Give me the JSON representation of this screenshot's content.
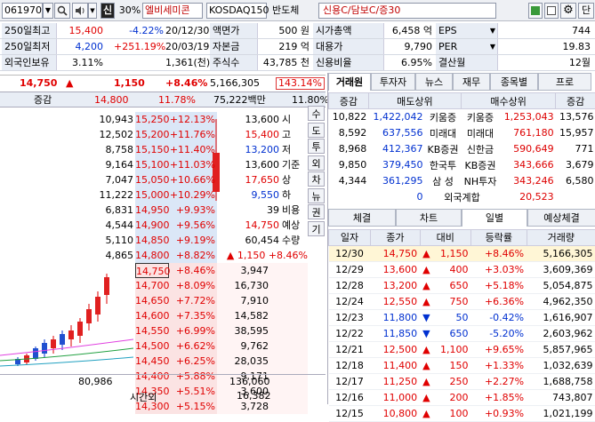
{
  "toolbar": {
    "code": "061970",
    "toggle_label": "신",
    "pct_badge": "30%",
    "name": "엘비세미콘",
    "market": "KOSDAQ150",
    "sector": "반도체",
    "credit": "신용C/담보C/증30"
  },
  "info": {
    "rows": [
      [
        {
          "k": "250일최고",
          "dd": "▼"
        },
        {
          "v": "15,400",
          "cls": "red"
        },
        {
          "v": "-4.22%",
          "cls": "blue"
        },
        {
          "v": "20/12/30"
        },
        {
          "k": "액면가"
        },
        {
          "v": "500 원"
        },
        {
          "k": "시가총액"
        },
        {
          "v": "6,458 억"
        },
        {
          "k": "EPS",
          "dd": "▼"
        },
        {
          "v": "744"
        }
      ],
      [
        {
          "k": "250일최저",
          "dd": "▼"
        },
        {
          "v": "4,200",
          "cls": "blue"
        },
        {
          "v": "+251.19%",
          "cls": "red"
        },
        {
          "v": "20/03/19"
        },
        {
          "k": "자본금"
        },
        {
          "v": "219 억"
        },
        {
          "k": "대용가"
        },
        {
          "v": "9,790"
        },
        {
          "k": "PER",
          "dd": "▼"
        },
        {
          "v": "19.83"
        }
      ],
      [
        {
          "k": "외국인보유"
        },
        {
          "v": "3.11%"
        },
        {
          "v": ""
        },
        {
          "v": "1,361(천)"
        },
        {
          "k": "주식수"
        },
        {
          "v": "43,785 천"
        },
        {
          "k": "신용비율"
        },
        {
          "v": "6.95%"
        },
        {
          "k": "결산월"
        },
        {
          "v": "12월"
        }
      ]
    ]
  },
  "price": {
    "current": "14,750",
    "arrow": "▲",
    "change": "1,150",
    "pct": "+8.46%",
    "volume": "5,166,305",
    "vol_ratio": "143.14%"
  },
  "ob_header": {
    "label": "증감",
    "price": "14,800",
    "pct": "11.78%",
    "amount": "75,222백만",
    "pct2": "11.80%"
  },
  "asks": [
    {
      "qty": "10,943",
      "price": "15,250",
      "pct": "+12.13%"
    },
    {
      "qty": "12,502",
      "price": "15,200",
      "pct": "+11.76%"
    },
    {
      "qty": "8,758",
      "price": "15,150",
      "pct": "+11.40%"
    },
    {
      "qty": "9,164",
      "price": "15,100",
      "pct": "+11.03%"
    },
    {
      "qty": "7,047",
      "price": "15,050",
      "pct": "+10.66%"
    },
    {
      "qty": "11,222",
      "price": "15,000",
      "pct": "+10.29%"
    },
    {
      "qty": "6,831",
      "price": "14,950",
      "pct": "+9.93%"
    },
    {
      "qty": "4,544",
      "price": "14,900",
      "pct": "+9.56%"
    },
    {
      "qty": "5,110",
      "price": "14,850",
      "pct": "+9.19%"
    },
    {
      "qty": "4,865",
      "price": "14,800",
      "pct": "+8.82%"
    }
  ],
  "summary": [
    {
      "v": "13,600",
      "k": "시",
      "vcls": "bk"
    },
    {
      "v": "15,400",
      "k": "고",
      "vcls": "red"
    },
    {
      "v": "13,200",
      "k": "저",
      "vcls": "blue"
    },
    {
      "v": "13,600",
      "k": "기준",
      "vcls": "bk"
    },
    {
      "v": "17,650",
      "k": "상",
      "vcls": "red"
    },
    {
      "v": "9,550",
      "k": "하",
      "vcls": "blue"
    },
    {
      "v": "39",
      "k": "비용",
      "vcls": "bk"
    },
    {
      "v": "14,750",
      "k": "예상",
      "vcls": "red"
    },
    {
      "v": "60,454",
      "k": "수량",
      "vcls": "bk"
    },
    {
      "v": "▲ 1,150  +8.46%",
      "k": "",
      "vcls": "red"
    }
  ],
  "side_tabs": [
    "수",
    "도",
    "투",
    "외",
    "차",
    "뉴",
    "권",
    "기"
  ],
  "bids": [
    {
      "price": "14,750",
      "pct": "+8.46%",
      "qty": "3,947"
    },
    {
      "price": "14,700",
      "pct": "+8.09%",
      "qty": "16,730"
    },
    {
      "price": "14,650",
      "pct": "+7.72%",
      "qty": "7,910"
    },
    {
      "price": "14,600",
      "pct": "+7.35%",
      "qty": "14,582"
    },
    {
      "price": "14,550",
      "pct": "+6.99%",
      "qty": "38,595"
    },
    {
      "price": "14,500",
      "pct": "+6.62%",
      "qty": "9,762"
    },
    {
      "price": "14,450",
      "pct": "+6.25%",
      "qty": "28,035"
    },
    {
      "price": "14,400",
      "pct": "+5.88%",
      "qty": "9,171"
    },
    {
      "price": "14,350",
      "pct": "+5.51%",
      "qty": "3,600"
    },
    {
      "price": "14,300",
      "pct": "+5.15%",
      "qty": "3,728"
    }
  ],
  "ob_footer": {
    "ask_total": "80,986",
    "bid_total": "136,060",
    "label": "시간외",
    "after": "16,382"
  },
  "broker": {
    "tabs": [
      "거래원",
      "투자자",
      "뉴스",
      "재무",
      "종목별",
      "프로"
    ],
    "head": [
      "증감",
      "매도상위",
      "매수상위",
      "증감"
    ],
    "rows": [
      [
        "10,822",
        "1,422,042",
        "키움증",
        "키움증",
        "1,253,043",
        "13,576"
      ],
      [
        "8,592",
        "637,556",
        "미래대",
        "미래대",
        "761,180",
        "15,957"
      ],
      [
        "8,968",
        "412,367",
        "KB증권",
        "신한금",
        "590,649",
        "771"
      ],
      [
        "9,850",
        "379,450",
        "한국투",
        "KB증권",
        "343,666",
        "3,679"
      ],
      [
        "4,344",
        "361,295",
        "삼 성",
        "NH투자",
        "343,246",
        "6,580"
      ]
    ],
    "foreign_zero": "0",
    "foreign_label": "외국계합",
    "foreign_total": "20,523"
  },
  "daily": {
    "tabs": [
      "체결",
      "차트",
      "일별",
      "예상체결"
    ],
    "head": [
      "일자",
      "종가",
      "대비",
      "등락률",
      "거래량"
    ],
    "rows": [
      {
        "d": "12/30",
        "p": "14,750",
        "a": "▲",
        "c": "1,150",
        "r": "+8.46%",
        "v": "5,166,305",
        "up": true
      },
      {
        "d": "12/29",
        "p": "13,600",
        "a": "▲",
        "c": "400",
        "r": "+3.03%",
        "v": "3,609,369",
        "up": true
      },
      {
        "d": "12/28",
        "p": "13,200",
        "a": "▲",
        "c": "650",
        "r": "+5.18%",
        "v": "5,054,875",
        "up": true
      },
      {
        "d": "12/24",
        "p": "12,550",
        "a": "▲",
        "c": "750",
        "r": "+6.36%",
        "v": "4,962,350",
        "up": true
      },
      {
        "d": "12/23",
        "p": "11,800",
        "a": "▼",
        "c": "50",
        "r": "-0.42%",
        "v": "1,616,907",
        "up": false
      },
      {
        "d": "12/22",
        "p": "11,850",
        "a": "▼",
        "c": "650",
        "r": "-5.20%",
        "v": "2,603,962",
        "up": false
      },
      {
        "d": "12/21",
        "p": "12,500",
        "a": "▲",
        "c": "1,100",
        "r": "+9.65%",
        "v": "5,857,965",
        "up": true
      },
      {
        "d": "12/18",
        "p": "11,400",
        "a": "▲",
        "c": "150",
        "r": "+1.33%",
        "v": "1,032,639",
        "up": true
      },
      {
        "d": "12/17",
        "p": "11,250",
        "a": "▲",
        "c": "250",
        "r": "+2.27%",
        "v": "1,688,758",
        "up": true
      },
      {
        "d": "12/16",
        "p": "11,000",
        "a": "▲",
        "c": "200",
        "r": "+1.85%",
        "v": "743,807",
        "up": true
      },
      {
        "d": "12/15",
        "p": "10,800",
        "a": "▲",
        "c": "100",
        "r": "+0.93%",
        "v": "1,021,199",
        "up": true
      }
    ]
  },
  "icons": {
    "search": "search-icon",
    "speaker": "speaker-icon",
    "gear": "gear-icon",
    "print": "print-icon"
  },
  "colors": {
    "up": "#e00000",
    "down": "#0030d0",
    "ask_bg": "#dbe7f7",
    "bid_bg": "#fbe3e3"
  }
}
